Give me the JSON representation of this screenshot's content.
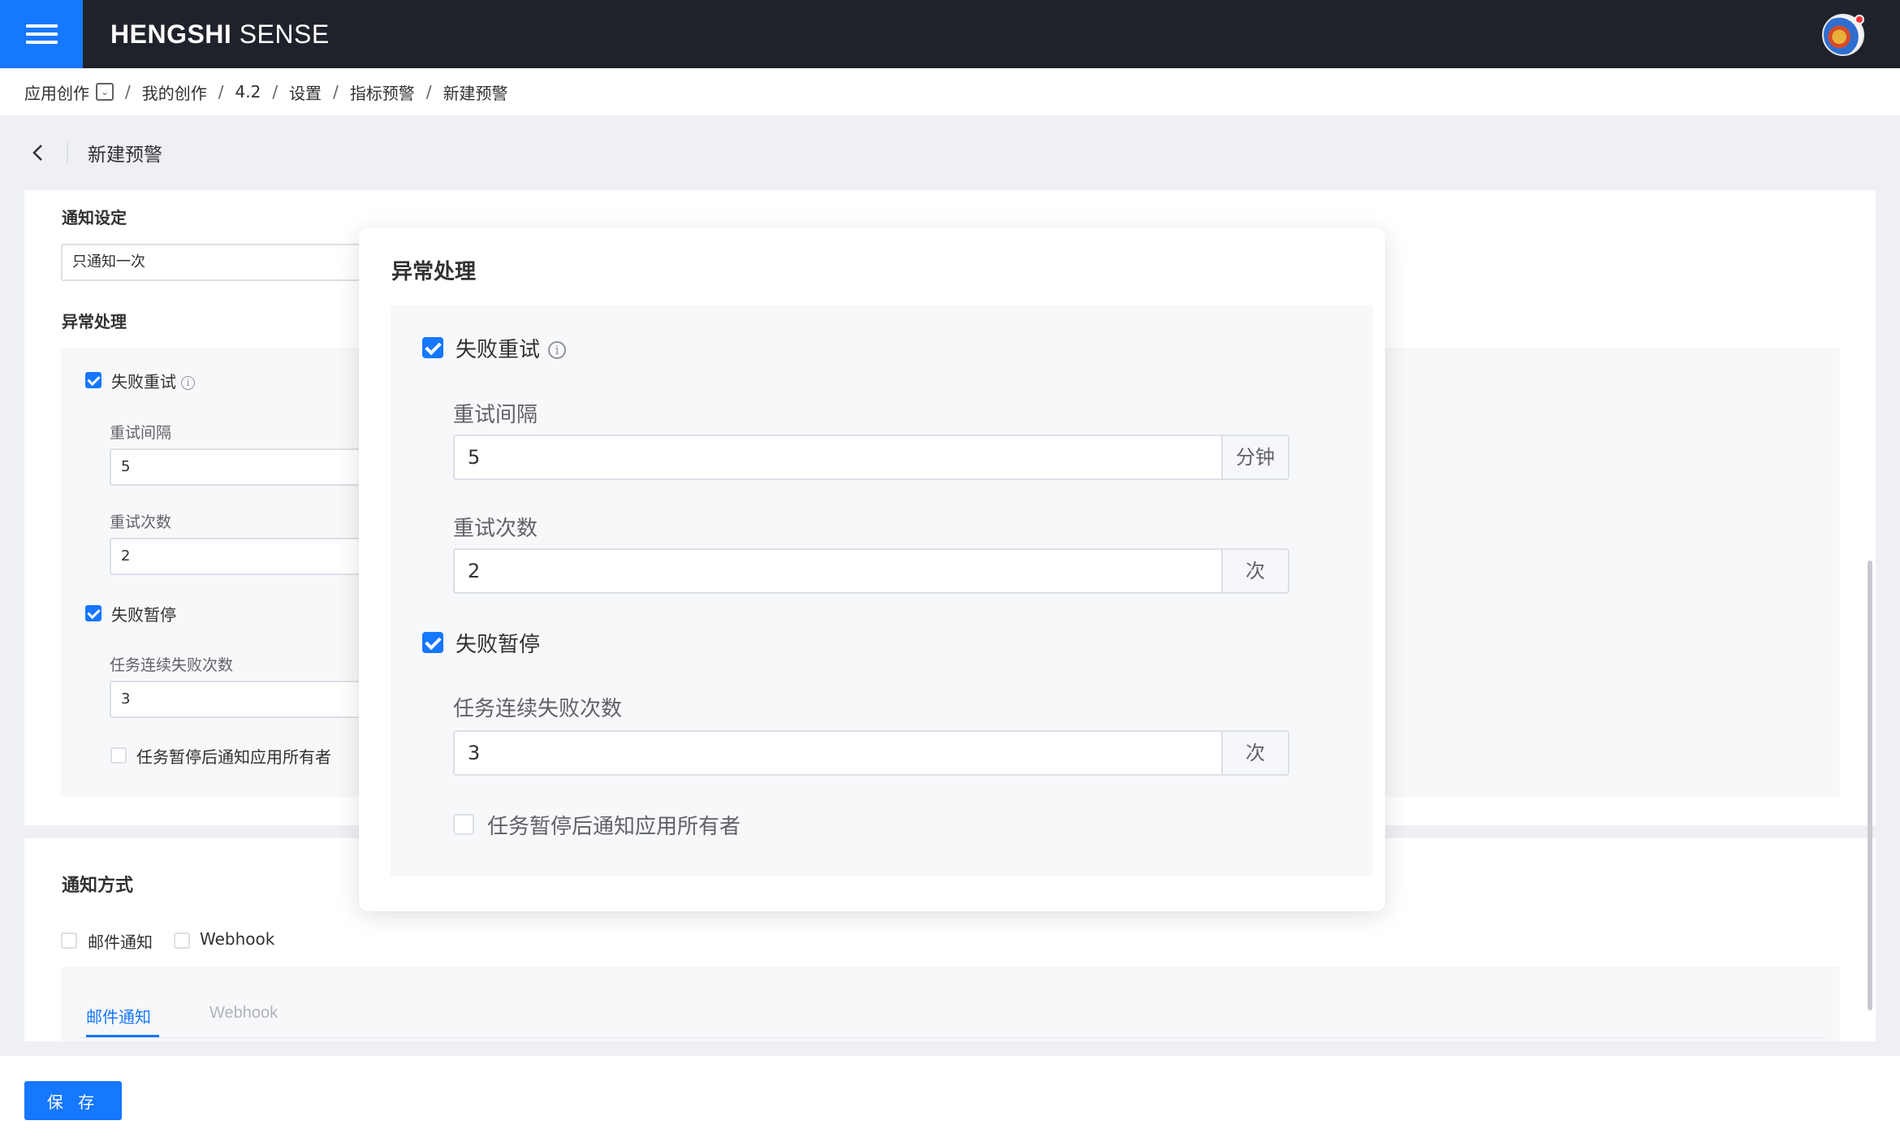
{
  "app": {
    "brand_bold": "HENGSHI",
    "brand_light": "SENSE"
  },
  "breadcrumb": {
    "items": [
      "应用创作",
      "我的创作",
      "4.2",
      "设置",
      "指标预警",
      "新建预警"
    ],
    "separator": "/"
  },
  "page": {
    "title": "新建预警"
  },
  "notify_settings": {
    "label": "通知设定",
    "value": "只通知一次"
  },
  "exception": {
    "label": "异常处理",
    "retry_on_fail": {
      "label": "失败重试",
      "checked": true
    },
    "retry_interval": {
      "label": "重试间隔",
      "value": "5",
      "unit": "分钟"
    },
    "retry_count": {
      "label": "重试次数",
      "value": "2",
      "unit": "次"
    },
    "pause_on_fail": {
      "label": "失败暂停",
      "checked": true
    },
    "consecutive_failures": {
      "label": "任务连续失败次数",
      "value": "3",
      "unit": "次"
    },
    "notify_owners": {
      "label": "任务暂停后通知应用所有者",
      "checked": false
    }
  },
  "notify_method": {
    "label": "通知方式",
    "options": [
      {
        "label": "邮件通知",
        "checked": false
      },
      {
        "label": "Webhook",
        "checked": false
      }
    ],
    "tabs": [
      {
        "label": "邮件通知",
        "active": true
      },
      {
        "label": "Webhook",
        "active": false
      }
    ]
  },
  "footer": {
    "save_label": "保 存"
  },
  "colors": {
    "primary": "#1677ff",
    "topbar": "#20222b",
    "page_bg": "#eef0f4"
  },
  "icons": {
    "menu": "hamburger-icon",
    "back": "chevron-left-icon",
    "dropdown": "chevron-down-icon",
    "info": "info-circle-icon"
  }
}
